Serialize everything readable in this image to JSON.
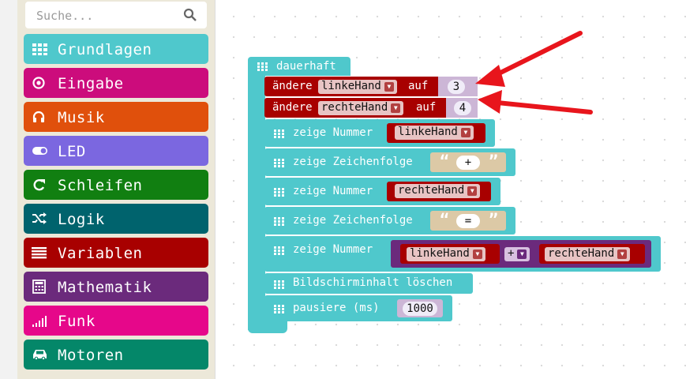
{
  "search": {
    "placeholder": "Suche..."
  },
  "categories": [
    {
      "label": "Grundlagen",
      "color": "#4fc8cc",
      "icon": "grid-icon"
    },
    {
      "label": "Eingabe",
      "color": "#cc0c7c",
      "icon": "circle-dot-icon"
    },
    {
      "label": "Musik",
      "color": "#e0500c",
      "icon": "headphones-icon"
    },
    {
      "label": "LED",
      "color": "#7b67e0",
      "icon": "toggle-icon"
    },
    {
      "label": "Schleifen",
      "color": "#117f11",
      "icon": "refresh-icon"
    },
    {
      "label": "Logik",
      "color": "#00636d",
      "icon": "shuffle-icon"
    },
    {
      "label": "Variablen",
      "color": "#a80000",
      "icon": "list-icon"
    },
    {
      "label": "Mathematik",
      "color": "#6b2a7c",
      "icon": "calculator-icon"
    },
    {
      "label": "Funk",
      "color": "#e6078a",
      "icon": "signal-icon"
    },
    {
      "label": "Motoren",
      "color": "#048769",
      "icon": "car-icon"
    }
  ],
  "blocks": {
    "forever_label": "dauerhaft",
    "set1": {
      "a": "ändere",
      "var": "linkeHand",
      "b": "auf",
      "value": "3"
    },
    "set2": {
      "a": "ändere",
      "var": "rechteHand",
      "b": "auf",
      "value": "4"
    },
    "show1": {
      "label": "zeige Nummer",
      "var": "linkeHand"
    },
    "show2": {
      "label": "zeige Zeichenfolge",
      "text": "+"
    },
    "show3": {
      "label": "zeige Nummer",
      "var": "rechteHand"
    },
    "show4": {
      "label": "zeige Zeichenfolge",
      "text": "="
    },
    "show5": {
      "label": "zeige Nummer",
      "left": "linkeHand",
      "op": "+",
      "right": "rechteHand"
    },
    "clear": {
      "label": "Bildschirminhalt löschen"
    },
    "pause": {
      "label": "pausiere (ms)",
      "value": "1000"
    },
    "quote_open": "“",
    "quote_close": "”"
  },
  "colors": {
    "basic": "#4fc8cc",
    "variables": "#a80000",
    "math": "#6b2a7c",
    "arrow": "#e8151c"
  }
}
